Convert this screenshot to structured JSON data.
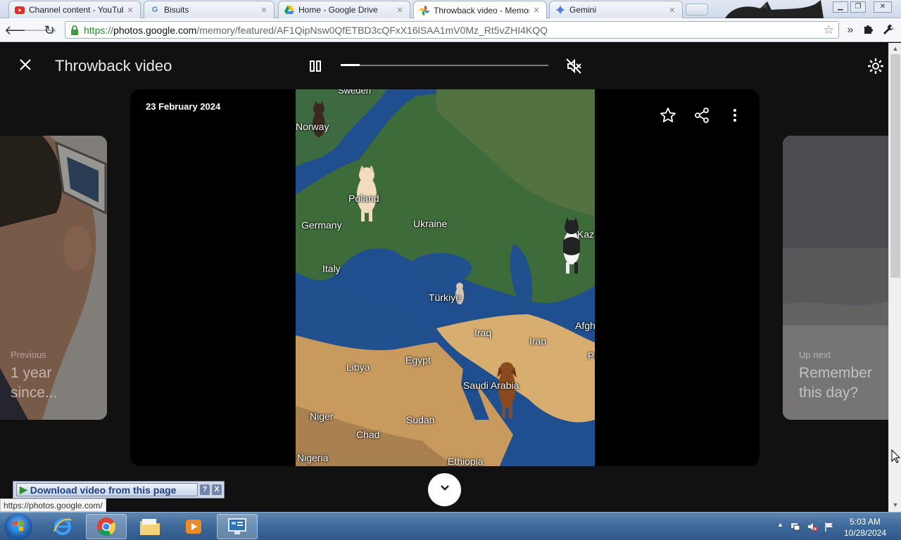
{
  "browser": {
    "tabs": [
      {
        "label": "Channel content - YouTube",
        "icon": "youtube-icon",
        "active": false
      },
      {
        "label": "Bisuits",
        "icon": "google-icon",
        "active": false
      },
      {
        "label": "Home - Google Drive",
        "icon": "google-drive-icon",
        "active": false
      },
      {
        "label": "Throwback video - Memories",
        "icon": "google-photos-icon",
        "active": true
      },
      {
        "label": "Gemini",
        "icon": "gemini-icon",
        "active": false
      }
    ],
    "url": {
      "protocol": "https://",
      "host": "photos.google.com",
      "path": "/memory/featured/AF1QipNsw0QfETBD3cQFxX16lSAA1mV0Mz_Rt5vZHI4KQQ"
    }
  },
  "viewer": {
    "title": "Throwback video",
    "progress": 0.09,
    "date": "23 February 2024",
    "map_places": [
      "Sweden",
      "Norway",
      "Poland",
      "Germany",
      "Ukraine",
      "Kazakhstan",
      "Italy",
      "Türkiye",
      "Iraq",
      "Iran",
      "Afghanistan",
      "Libya",
      "Egypt",
      "Saudi Arabia",
      "Niger",
      "Chad",
      "Sudan",
      "Nigeria",
      "Ethiopia",
      "Pakistan"
    ],
    "previous": {
      "label": "Previous",
      "text": "1 year since..."
    },
    "next": {
      "label": "Up next",
      "text": "Remember this day?"
    }
  },
  "extension_bar": {
    "download_label": "Download video from this page",
    "help_label": "?",
    "close_label": "X"
  },
  "status_bar": {
    "url": "https://photos.google.com/"
  },
  "taskbar": {
    "time": "5:03 AM",
    "date": "10/28/2024"
  },
  "colors": {
    "page_bg": "#111111",
    "card_bg": "#000000",
    "taskbar": "#3e6a9c",
    "ocean": "#1f4f8f",
    "desert": "#c99a5e"
  }
}
